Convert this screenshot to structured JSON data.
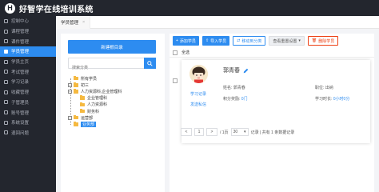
{
  "app": {
    "logo_letter": "H",
    "title": "好智学在线培训系统"
  },
  "sidebar": {
    "items": [
      {
        "label": "控制中心",
        "icon": "monitor-icon"
      },
      {
        "label": "课程管理",
        "icon": "course-icon"
      },
      {
        "label": "课件管理",
        "icon": "file-icon"
      },
      {
        "label": "学员管理",
        "icon": "users-icon"
      },
      {
        "label": "学员主页",
        "icon": "home-icon"
      },
      {
        "label": "考试管理",
        "icon": "exam-icon"
      },
      {
        "label": "学习记录",
        "icon": "record-icon"
      },
      {
        "label": "收藏管理",
        "icon": "star-icon"
      },
      {
        "label": "子管理员",
        "icon": "admin-icon"
      },
      {
        "label": "账号管理",
        "icon": "account-icon"
      },
      {
        "label": "系统设置",
        "icon": "gear-icon"
      },
      {
        "label": "退回问题",
        "icon": "question-icon"
      }
    ],
    "active_index": 3
  },
  "tabs": [
    {
      "label": "学员管理",
      "close": "×"
    }
  ],
  "left_panel": {
    "new_folder_label": "新建根目录",
    "search_placeholder": "搜索分类",
    "tree": [
      {
        "label": "所有学员",
        "level": 0,
        "expander": ""
      },
      {
        "label": "初三",
        "level": 0,
        "expander": "+"
      },
      {
        "label": "人力资源科,企业管理科",
        "level": 0,
        "expander": "+"
      },
      {
        "label": "企业管理科",
        "level": 1,
        "expander": ""
      },
      {
        "label": "人力资源科",
        "level": 1,
        "expander": ""
      },
      {
        "label": "财务科",
        "level": 1,
        "expander": ""
      },
      {
        "label": "运营部",
        "level": 0,
        "expander": "+"
      },
      {
        "label": "业务部",
        "level": 0,
        "expander": ""
      }
    ],
    "selected_index": 7
  },
  "toolbar": {
    "add_student": "添加学员",
    "import_students": "导入学员",
    "move_group": "移动到分类",
    "view_settings": "查看重置设置",
    "delete_students": "删除学员"
  },
  "select_all_label": "全选",
  "student_card": {
    "name": "郭青春",
    "study_record_link": "学习记录",
    "send_message_link": "发送私信",
    "name_field_label": "姓名:",
    "name_field_value": "郭青春",
    "points_label": "积分奖励:",
    "points_value": "0门",
    "position_label": "职位:",
    "position_value": "出纳",
    "study_time_label": "学习时长:",
    "study_time_value": "0小时0分"
  },
  "pagination": {
    "prev": "<",
    "page": "1",
    "next": ">",
    "total_pages_text": "/ 1页",
    "page_size": "30",
    "summary": "记录 | 共有 1 条数据记录"
  },
  "colors": {
    "accent": "#2d8cf0",
    "danger": "#ed4014",
    "sidebar_bg": "#23262e"
  }
}
